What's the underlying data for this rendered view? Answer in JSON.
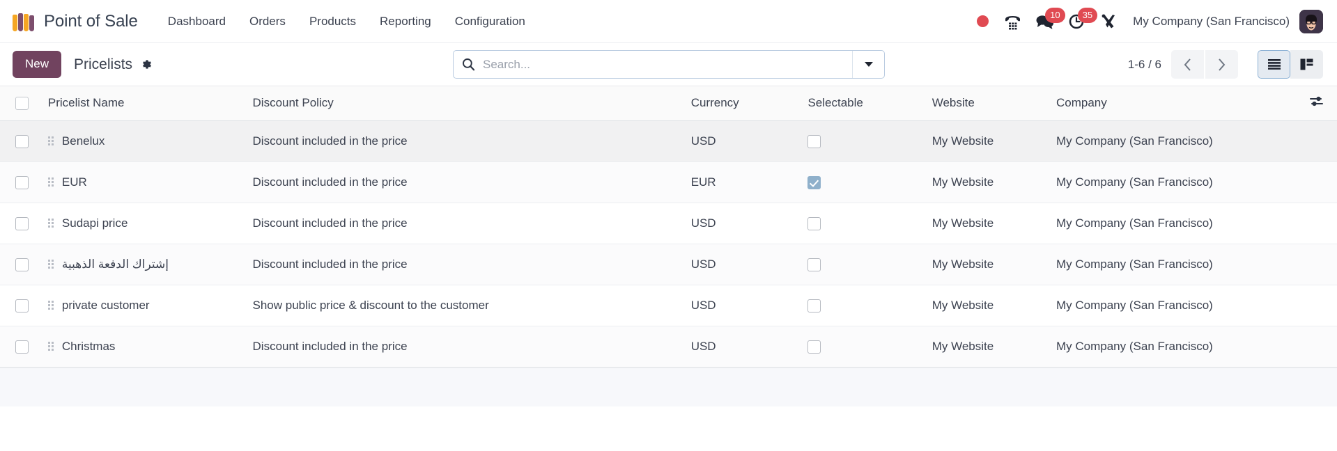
{
  "navbar": {
    "logo_icon": "pos-logo-icon",
    "brand": "Point of Sale",
    "menu": [
      {
        "label": "Dashboard"
      },
      {
        "label": "Orders"
      },
      {
        "label": "Products"
      },
      {
        "label": "Reporting"
      },
      {
        "label": "Configuration"
      }
    ],
    "systray": {
      "recording_icon": "record-dot-icon",
      "voip_icon": "phone-dialpad-icon",
      "messages_icon": "chat-bubbles-icon",
      "messages_count": "10",
      "activities_icon": "clock-icon",
      "activities_count": "35",
      "developer_icon": "tools-icon",
      "company": "My Company (San Francisco)",
      "avatar_icon": "user-avatar"
    }
  },
  "control_panel": {
    "new_label": "New",
    "title": "Pricelists",
    "settings_icon": "gear-icon",
    "search": {
      "icon": "search-icon",
      "value": "",
      "placeholder": "Search...",
      "toggle_icon": "chevron-down-icon"
    },
    "pager": {
      "value": "1-6 / 6",
      "prev_icon": "chevron-left-icon",
      "next_icon": "chevron-right-icon"
    },
    "views": [
      {
        "name": "list",
        "icon": "list-view-icon",
        "active": true
      },
      {
        "name": "kanban",
        "icon": "kanban-view-icon",
        "active": false
      }
    ]
  },
  "table": {
    "select_all_icon": "select-all-checkbox",
    "optional_columns_icon": "sliders-icon",
    "columns": [
      "Pricelist Name",
      "Discount Policy",
      "Currency",
      "Selectable",
      "Website",
      "Company"
    ],
    "rows": [
      {
        "name": "Benelux",
        "policy": "Discount included in the price",
        "currency": "USD",
        "selectable": false,
        "website": "My Website",
        "company": "My Company (San Francisco)",
        "rtl": false,
        "highlight": true
      },
      {
        "name": "EUR",
        "policy": "Discount included in the price",
        "currency": "EUR",
        "selectable": true,
        "website": "My Website",
        "company": "My Company (San Francisco)",
        "rtl": false,
        "highlight": false
      },
      {
        "name": "Sudapi price",
        "policy": "Discount included in the price",
        "currency": "USD",
        "selectable": false,
        "website": "My Website",
        "company": "My Company (San Francisco)",
        "rtl": false,
        "highlight": false
      },
      {
        "name": "إشتراك الدفعة الذهبية",
        "policy": "Discount included in the price",
        "currency": "USD",
        "selectable": false,
        "website": "My Website",
        "company": "My Company (San Francisco)",
        "rtl": true,
        "highlight": false
      },
      {
        "name": "private customer",
        "policy": "Show public price & discount to the customer",
        "currency": "USD",
        "selectable": false,
        "website": "My Website",
        "company": "My Company (San Francisco)",
        "rtl": false,
        "highlight": false
      },
      {
        "name": "Christmas",
        "policy": "Discount included in the price",
        "currency": "USD",
        "selectable": false,
        "website": "My Website",
        "company": "My Company (San Francisco)",
        "rtl": false,
        "highlight": false
      }
    ]
  },
  "colors": {
    "brand_purple": "#71435f",
    "accent_red": "#e04a52",
    "text": "#3c4250",
    "checkbox_checked": "#8fb0cb"
  }
}
